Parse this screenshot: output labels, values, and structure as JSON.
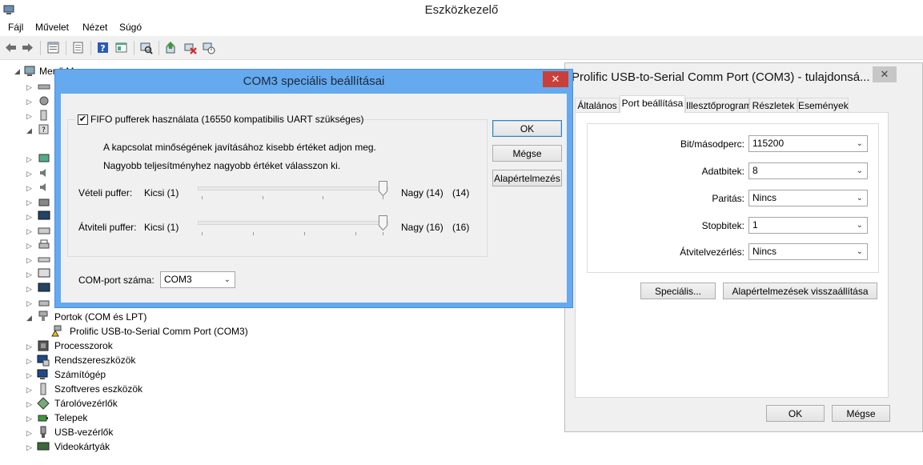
{
  "main": {
    "title": "Eszközkezelő",
    "menu": [
      "Fájl",
      "Művelet",
      "Nézet",
      "Súgó"
    ],
    "tree": {
      "root": "Menő Mo...",
      "ports_label": "Portok (COM és LPT)",
      "port_child": "Prolific USB-to-Serial Comm Port (COM3)",
      "items": [
        "Processzorok",
        "Rendszereszközök",
        "Számítógép",
        "Szoftveres eszközök",
        "Tárolóvezérlők",
        "Telepek",
        "USB-vezérlők",
        "Videokártyák"
      ]
    }
  },
  "props": {
    "title": "Prolific USB-to-Serial Comm Port (COM3) - tulajdonsá...",
    "tabs": [
      "Általános",
      "Port beállítása",
      "Illesztőprogram",
      "Részletek",
      "Események"
    ],
    "fields": [
      {
        "label": "Bit/másodperc:",
        "value": "115200"
      },
      {
        "label": "Adatbitek:",
        "value": "8"
      },
      {
        "label": "Paritás:",
        "value": "Nincs"
      },
      {
        "label": "Stopbitek:",
        "value": "1"
      },
      {
        "label": "Átvitelvezérlés:",
        "value": "Nincs"
      }
    ],
    "advanced_btn": "Speciális...",
    "restore_btn": "Alapértelmezések visszaállítása",
    "ok": "OK",
    "cancel": "Mégse"
  },
  "adv": {
    "title": "COM3 speciális beállításai",
    "fifo_label": "FIFO pufferek használata (16550 kompatibilis UART szükséges)",
    "fifo_checked": true,
    "hint1": "A kapcsolat minőségének javításához kisebb értéket adjon meg.",
    "hint2": "Nagyobb teljesítményhez nagyobb értéket válasszon ki.",
    "rx_label": "Vételi puffer:",
    "rx_min": "Kicsi (1)",
    "rx_max": "Nagy (14)",
    "rx_value": "(14)",
    "rx_level": 1.0,
    "tx_label": "Átviteli puffer:",
    "tx_min": "Kicsi (1)",
    "tx_max": "Nagy (16)",
    "tx_value": "(16)",
    "tx_level": 1.0,
    "com_label": "COM-port száma:",
    "com_value": "COM3",
    "ok": "OK",
    "cancel": "Mégse",
    "defaults": "Alapértelmezés",
    "close_glyph": "✕"
  }
}
